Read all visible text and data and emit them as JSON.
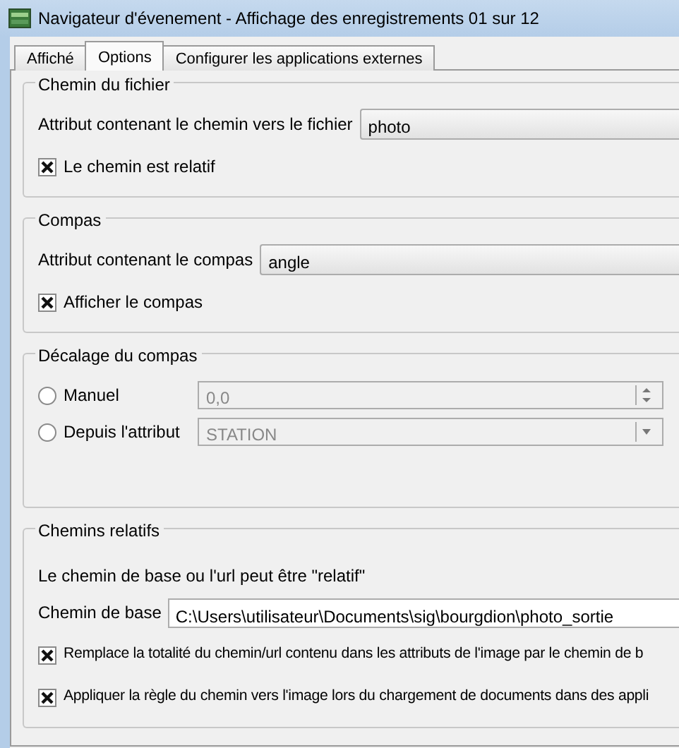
{
  "window": {
    "title": "Navigateur d'évenement - Affichage des enregistrements 01 sur 12"
  },
  "tabs": [
    {
      "label": "Affiché",
      "selected": false
    },
    {
      "label": "Options",
      "selected": true
    },
    {
      "label": "Configurer les applications externes",
      "selected": false
    }
  ],
  "groups": [
    {
      "title": "Chemin du fichier",
      "rows": [
        {
          "kind": "combo",
          "label": "Attribut contenant le chemin vers le fichier",
          "value": "photo",
          "disabled": false
        },
        {
          "kind": "checkbox",
          "label": "Le chemin est relatif",
          "checked": true
        }
      ]
    },
    {
      "title": "Compas",
      "rows": [
        {
          "kind": "combo",
          "label": "Attribut contenant le compas",
          "value": "angle",
          "disabled": false
        },
        {
          "kind": "checkbox",
          "label": "Afficher le compas",
          "checked": true
        }
      ]
    },
    {
      "title": "Décalage du compas",
      "rows": [
        {
          "kind": "radio-spin",
          "label": "Manuel",
          "selected": false,
          "value": "0,0",
          "disabled": true
        },
        {
          "kind": "radio-combo",
          "label": "Depuis l'attribut",
          "selected": false,
          "value": "STATION",
          "disabled": true
        }
      ]
    },
    {
      "title": "Chemins relatifs",
      "rows": [
        {
          "kind": "text",
          "label": "Le chemin de base ou l'url peut être \"relatif\""
        },
        {
          "kind": "field",
          "label": "Chemin de base",
          "value": "C:\\Users\\utilisateur\\Documents\\sig\\bourgdion\\photo_sortie"
        },
        {
          "kind": "checkbox",
          "label": "Remplace la totalité du chemin/url contenu dans les attributs de l'image par le chemin de b",
          "checked": true
        },
        {
          "kind": "checkbox",
          "label": "Appliquer la règle du chemin vers l'image lors du chargement de documents dans des appli",
          "checked": true
        }
      ]
    }
  ]
}
